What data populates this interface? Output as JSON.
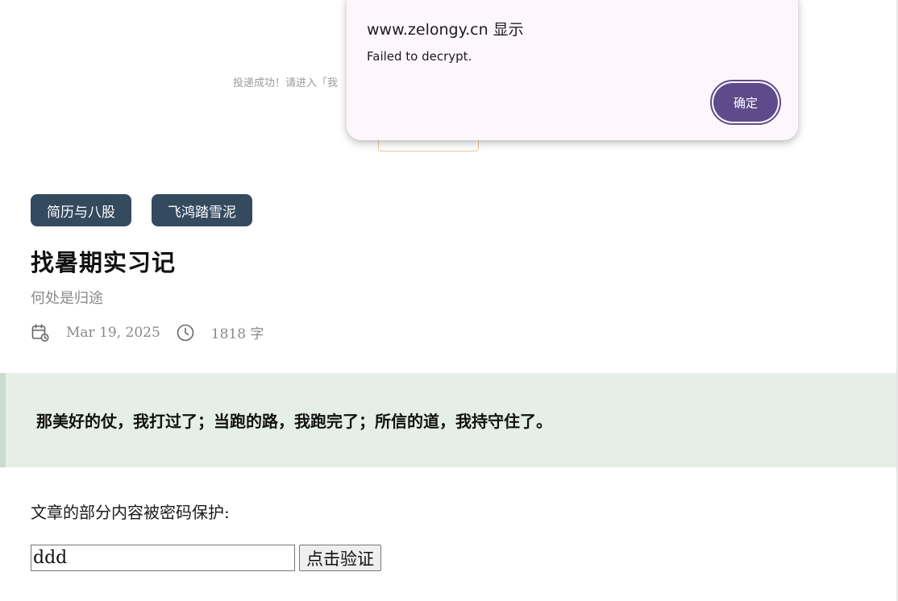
{
  "background": {
    "submit_notice": "投递成功！请进入「我"
  },
  "tags": [
    {
      "label": "简历与八股"
    },
    {
      "label": "飞鸿踏雪泥"
    }
  ],
  "post": {
    "title": "找暑期实习记",
    "subtitle": "何处是归途",
    "date": "Mar 19, 2025",
    "word_count": "1818 字",
    "quote": "那美好的仗，我打过了；当跑的路，我跑完了；所信的道，我持守住了。"
  },
  "protection": {
    "label": "文章的部分内容被密码保护:",
    "input_value": "ddd",
    "verify_label": "点击验证"
  },
  "alert": {
    "title": "www.zelongy.cn 显示",
    "message": "Failed to decrypt.",
    "ok_label": "确定"
  },
  "colors": {
    "tag_bg": "#344a5f",
    "quote_bg": "#e5efe7",
    "quote_border": "#c9dccd",
    "dialog_bg": "#fdf7fc",
    "dialog_button": "#5f4b8b"
  },
  "icons": {
    "date": "calendar-icon",
    "words": "clock-icon"
  }
}
